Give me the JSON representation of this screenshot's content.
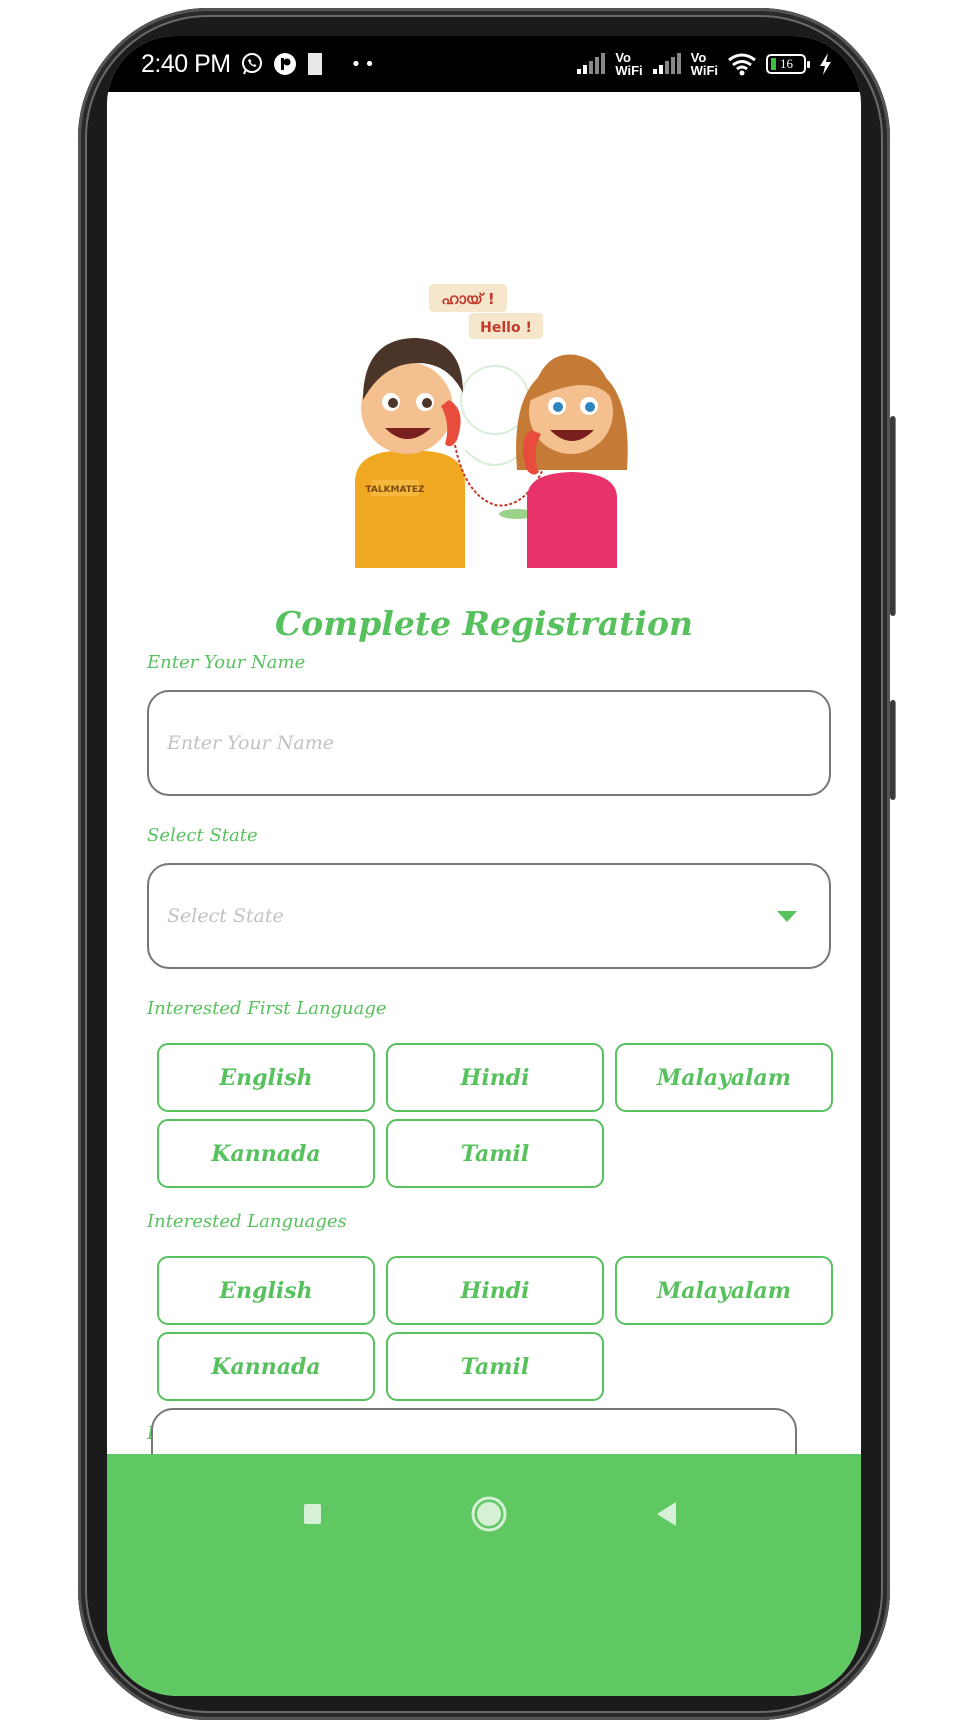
{
  "status_bar": {
    "time": "2:40 PM",
    "left_icons": [
      "whatsapp-icon",
      "app-notification-icon",
      "sim-card-icon"
    ],
    "overflow": "••",
    "sim1": {
      "signal": "signal-bars-icon",
      "label_top": "Vo",
      "label_bottom": "WiFi"
    },
    "sim2": {
      "signal": "signal-bars-icon",
      "label_top": "Vo",
      "label_bottom": "WiFi"
    },
    "wifi_icon": "wifi-icon",
    "battery_level": "16",
    "charging_icon": "lightning-icon"
  },
  "hero": {
    "bubble_1": "ഹായ് !",
    "bubble_2": "Hello !",
    "shirt_text": "TALKMATEZ"
  },
  "page": {
    "title": "Complete Registration"
  },
  "form": {
    "name": {
      "label": "Enter Your Name",
      "placeholder": "Enter Your Name",
      "value": ""
    },
    "state": {
      "label": "Select State",
      "placeholder": "Select State",
      "value": ""
    },
    "first_language": {
      "label": "Interested First Language",
      "options": [
        "English",
        "Hindi",
        "Malayalam",
        "Kannada",
        "Tamil"
      ]
    },
    "languages": {
      "label": "Interested Languages",
      "options": [
        "English",
        "Hindi",
        "Malayalam",
        "Kannada",
        "Tamil"
      ]
    },
    "passcode": {
      "label": "Enter Passcode",
      "value": ""
    }
  },
  "theme": {
    "accent": "#57c15d",
    "nav_bar": "#5fc862",
    "border": "#777777",
    "placeholder": "#c2c2c2"
  },
  "nav_bar": {
    "recent": "recent-apps-icon",
    "home": "home-icon",
    "back": "back-icon"
  }
}
